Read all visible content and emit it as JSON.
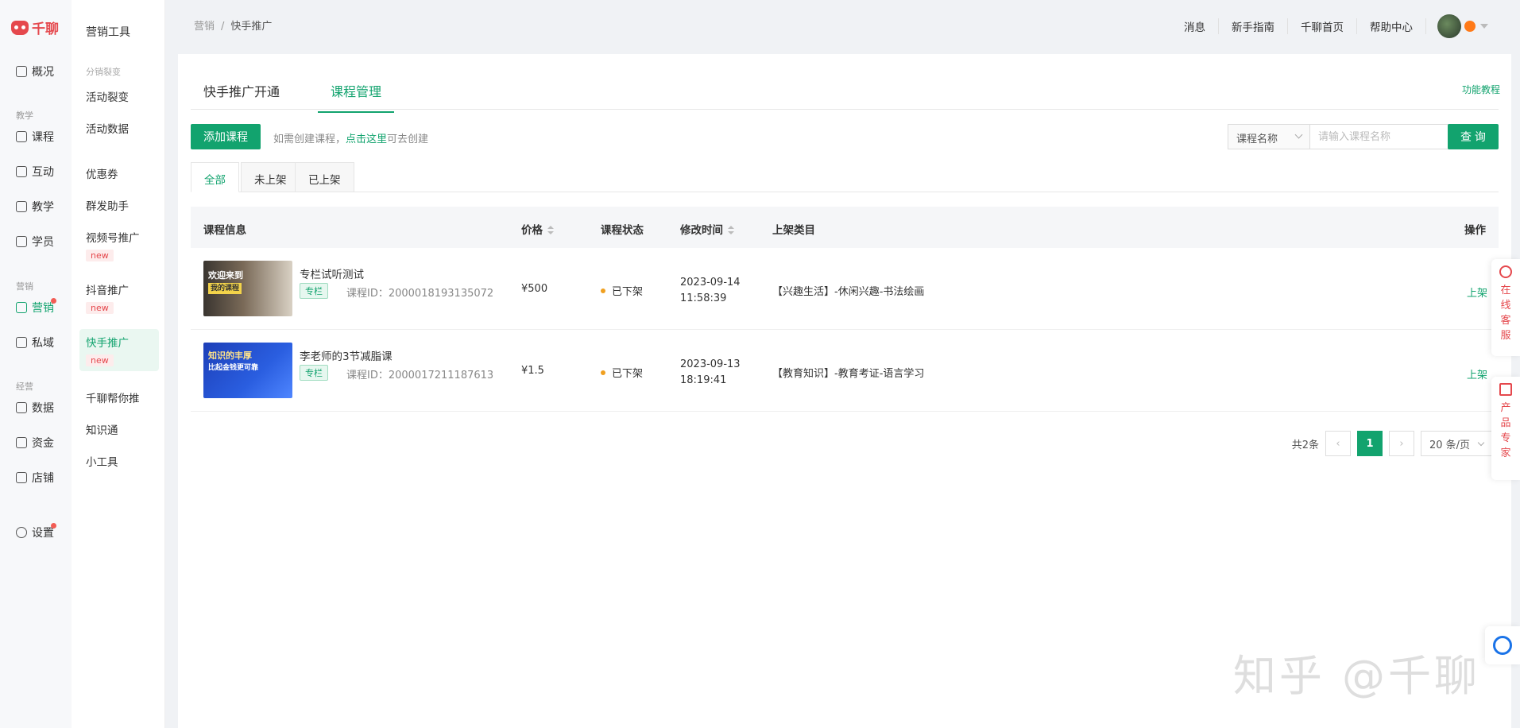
{
  "brand": {
    "name": "千聊"
  },
  "primary_nav": {
    "items": [
      {
        "label": "概况",
        "icon": "dashboard-icon"
      },
      {
        "group": "教学"
      },
      {
        "label": "课程",
        "icon": "grid-icon"
      },
      {
        "label": "互动",
        "icon": "interaction-icon"
      },
      {
        "label": "教学",
        "icon": "tools-icon"
      },
      {
        "label": "学员",
        "icon": "users-icon"
      },
      {
        "group": "营销"
      },
      {
        "label": "营销",
        "icon": "megaphone-icon",
        "active": true
      },
      {
        "label": "私域",
        "icon": "private-domain-icon"
      },
      {
        "group": "经营"
      },
      {
        "label": "数据",
        "icon": "chart-icon"
      },
      {
        "label": "资金",
        "icon": "wallet-icon"
      },
      {
        "label": "店铺",
        "icon": "store-icon"
      },
      {
        "label": "设置",
        "icon": "settings-icon"
      }
    ]
  },
  "secondary_nav": {
    "title": "营销工具",
    "group_distribution": "分销裂变",
    "items": {
      "activity_fission": "活动裂变",
      "activity_data": "活动数据",
      "coupon": "优惠券",
      "mass_send": "群发助手",
      "video_promo": "视频号推广",
      "douyin_promo": "抖音推广",
      "kuaishou_promo": "快手推广",
      "help_push": "千聊帮你推",
      "zhishitong": "知识通",
      "small_tools": "小工具"
    },
    "new_badge": "new"
  },
  "breadcrumb": {
    "root": "营销",
    "sep": "/",
    "current": "快手推广"
  },
  "top_links": [
    "消息",
    "新手指南",
    "千聊首页",
    "帮助中心"
  ],
  "tabs": {
    "open": "快手推广开通",
    "manage": "课程管理"
  },
  "func_link": "功能教程",
  "toolbar": {
    "add_course": "添加课程",
    "hint_prefix": "如需创建课程，",
    "hint_link": "点击这里",
    "hint_suffix": "可去创建",
    "search_field": "课程名称",
    "search_placeholder": "请输入课程名称",
    "search_button": "查 询"
  },
  "subtabs": [
    "全部",
    "未上架",
    "已上架"
  ],
  "table": {
    "headers": {
      "info": "课程信息",
      "price": "价格",
      "status": "课程状态",
      "mtime": "修改时间",
      "category": "上架类目",
      "op": "操作"
    },
    "rows": [
      {
        "thumb_line1": "欢迎来到",
        "thumb_line2": "我的课程",
        "name": "专栏试听测试",
        "tag": "专栏",
        "id": "课程ID：2000018193135072",
        "price": "¥500",
        "status": "已下架",
        "date": "2023-09-14",
        "time": "11:58:39",
        "category": "【兴趣生活】-休闲兴趣-书法绘画",
        "op": "上架"
      },
      {
        "thumb_line1": "知识的丰厚",
        "thumb_line2": "比起金钱更可靠",
        "name": "李老师的3节减脂课",
        "tag": "专栏",
        "id": "课程ID：2000017211187613",
        "price": "¥1.5",
        "status": "已下架",
        "date": "2023-09-13",
        "time": "18:19:41",
        "category": "【教育知识】-教育考证-语言学习",
        "op": "上架"
      }
    ]
  },
  "pager": {
    "total": "共2条",
    "current": "1",
    "page_size": "20 条/页"
  },
  "float_widgets": {
    "service": [
      "在",
      "线",
      "客",
      "服"
    ],
    "expert": [
      "产",
      "品",
      "专",
      "家"
    ]
  },
  "watermark": "知乎 @千聊"
}
